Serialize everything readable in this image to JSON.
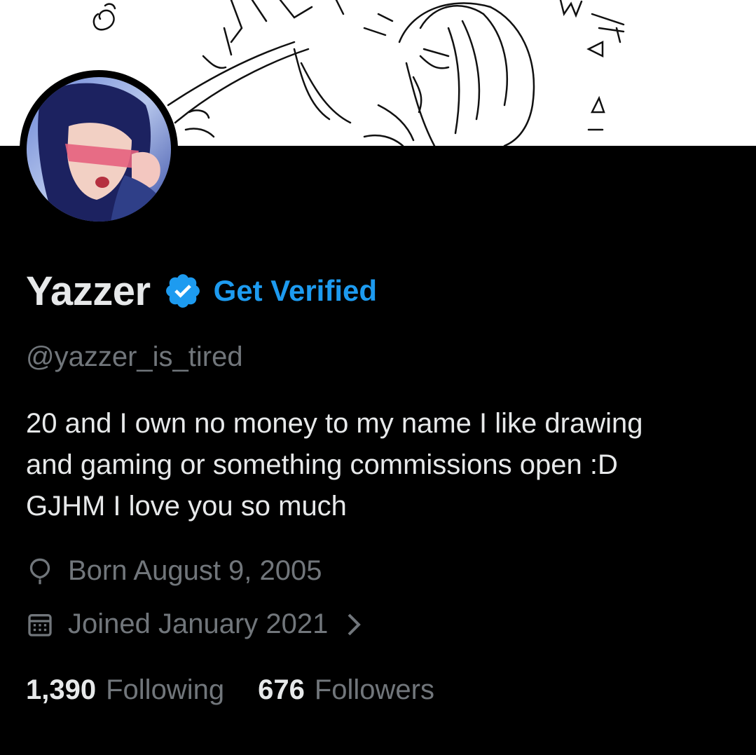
{
  "profile": {
    "display_name": "Yazzer",
    "get_verified_label": "Get Verified",
    "handle": "@yazzer_is_tired",
    "bio_lines": [
      "20 and I own no money to my name I like drawing",
      "and gaming or something commissions open :D",
      "GJHM I love you so much"
    ],
    "birthday": "Born August 9, 2005",
    "joined": "Joined January 2021",
    "following_count": "1,390",
    "following_label": "Following",
    "followers_count": "676",
    "followers_label": "Followers"
  },
  "icons": {
    "verified": "verified-badge-icon",
    "birthday": "balloon-icon",
    "joined": "calendar-icon",
    "chevron": "chevron-right-icon"
  },
  "colors": {
    "background": "#000000",
    "primary_text": "#e7e9ea",
    "secondary_text": "#71767b",
    "accent": "#1d9bf0"
  }
}
